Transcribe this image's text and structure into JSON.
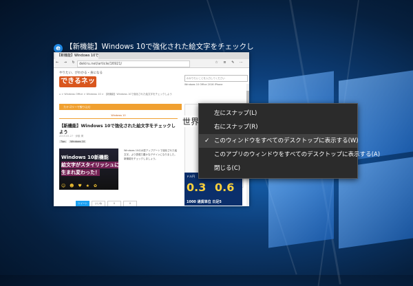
{
  "window": {
    "title": "【新機能】Windows 10で強化された絵文字をチェックしよう | できるネット - Micros..."
  },
  "browser": {
    "tab_label": "【新機能】Windows 10で強化",
    "url": "dekiru.net/article/16921/",
    "nav_glyphs": "← → ↻ ⌂",
    "tool_glyphs": "☆ ≡ ✎ ⋯"
  },
  "page": {
    "logo_tagline": "やりたい、がわかる・身になる",
    "logo_text": "できるネット",
    "search_placeholder": "わかりたいことを入力してください",
    "nav_tags": "Windows 10   Office 2016   iPhone",
    "breadcrumb": "⌂ > Windows Office > Windows 10 > 【新機能】Windows 10で強化された絵文字をチェックしよう",
    "category_label": "カテゴリーで絞り込む",
    "section_tag": "Windows 10",
    "article_title": "【新機能】Windows 10で強化された絵文字をチェックしよう",
    "meta": "2019.05.27 · 伊藤 潤",
    "tags": [
      "Tips",
      "Windows 10"
    ],
    "hero_line1": "Windows 10新機能",
    "hero_line2": "絵文字がスタイリッシュに",
    "hero_line3": "生まれ変わった！",
    "hero_emoji": "☺ ☻ ♥ ★ ✿",
    "body_text": "Windows 10の大型アップデートで強化された絵文字。より表現力豊かなデザインになりました。新機能をチェックしましょう。",
    "share_twitter": "ツイート",
    "share_like": "いいね",
    "share_count1": "0",
    "share_count2": "0",
    "ad_label": "ドル円",
    "ad_value1": "0.3",
    "ad_value2": "0.6",
    "ad_bottom": "1000 通貨単位  日足5"
  },
  "desktop_text": "世界",
  "context_menu": {
    "items": [
      {
        "label": "左にスナップ(L)",
        "checked": false
      },
      {
        "label": "右にスナップ(R)",
        "checked": false
      },
      {
        "label": "このウィンドウをすべてのデスクトップに表示する(W)",
        "checked": true
      },
      {
        "label": "このアプリのウィンドウをすべてのデスクトップに表示する(A)",
        "checked": false
      },
      {
        "label": "閉じる(C)",
        "checked": false
      }
    ],
    "check_glyph": "✓"
  }
}
